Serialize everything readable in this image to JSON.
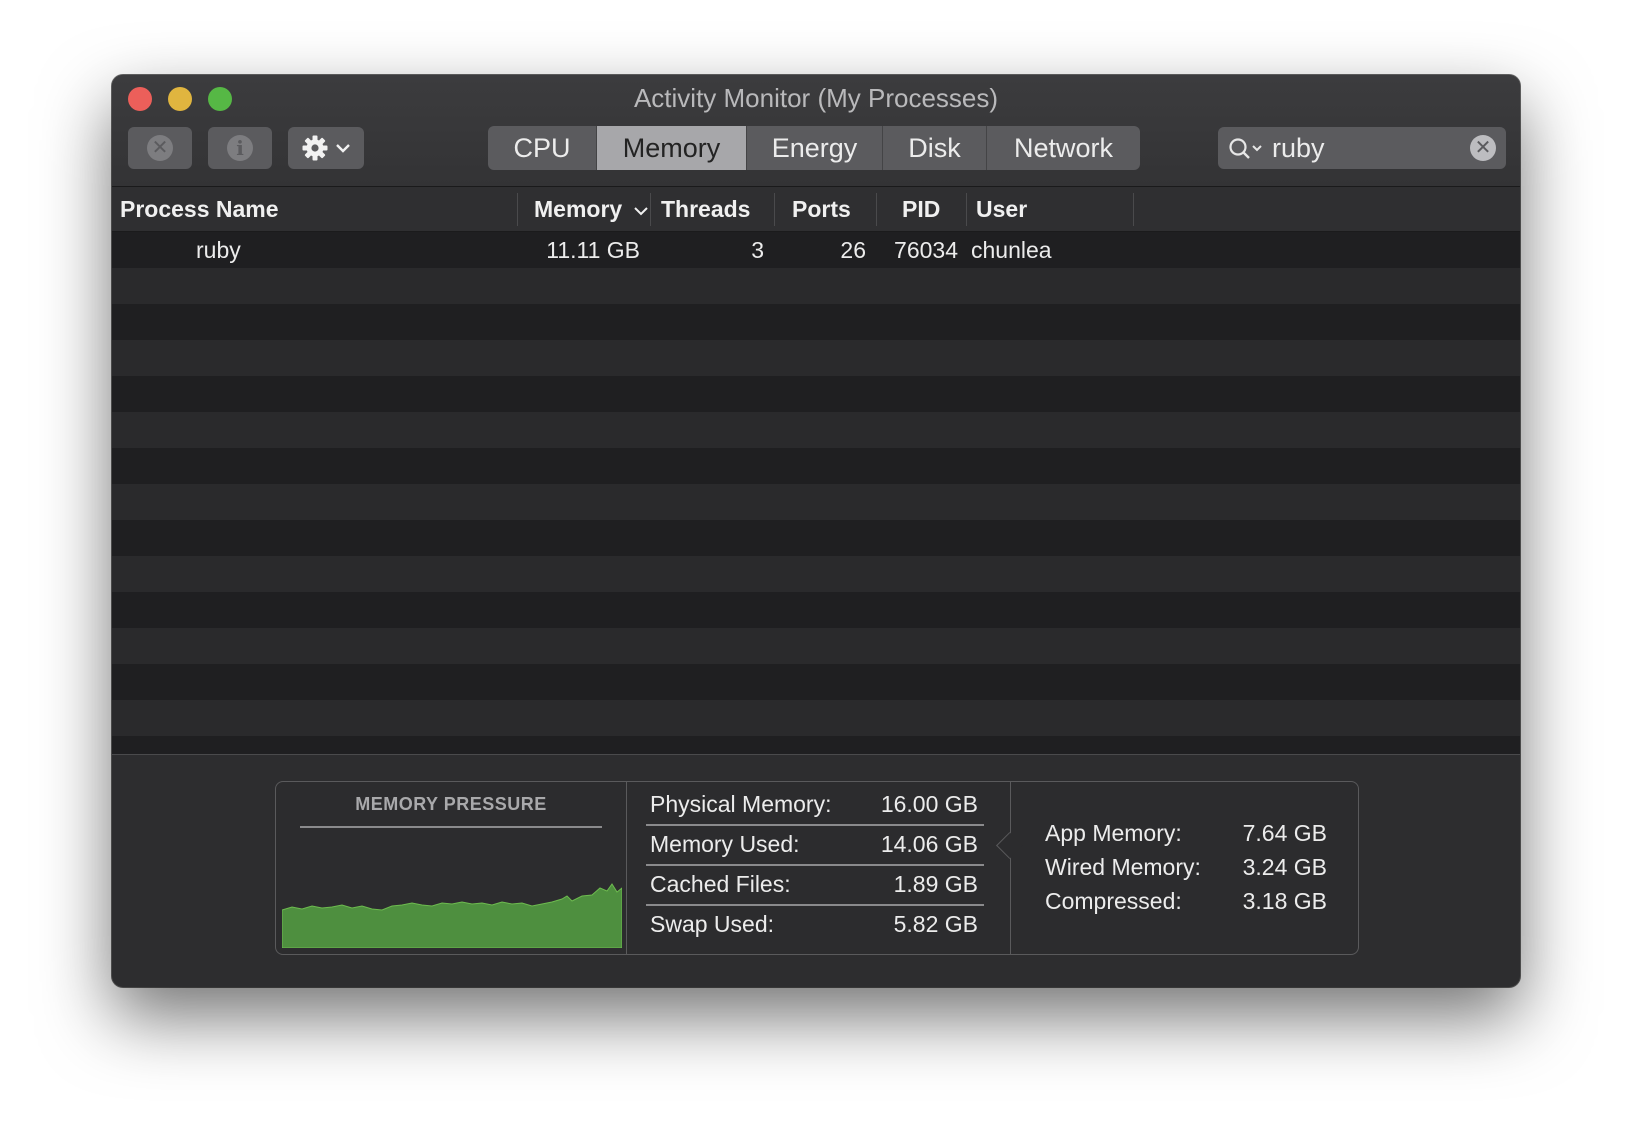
{
  "window": {
    "title": "Activity Monitor (My Processes)"
  },
  "toolbar": {
    "stop_icon": "stop-process-icon",
    "info_icon": "info-icon",
    "gear_icon": "gear-icon",
    "tabs": [
      {
        "label": "CPU",
        "active": false
      },
      {
        "label": "Memory",
        "active": true
      },
      {
        "label": "Energy",
        "active": false
      },
      {
        "label": "Disk",
        "active": false
      },
      {
        "label": "Network",
        "active": false
      }
    ],
    "search": {
      "value": "ruby"
    }
  },
  "table": {
    "columns": {
      "process_name": "Process Name",
      "memory": "Memory",
      "threads": "Threads",
      "ports": "Ports",
      "pid": "PID",
      "user": "User"
    },
    "sort_column": "Memory",
    "rows": [
      {
        "process_name": "ruby",
        "memory": "11.11 GB",
        "threads": "3",
        "ports": "26",
        "pid": "76034",
        "user": "chunlea"
      }
    ]
  },
  "stats": {
    "memory_pressure": {
      "title": "MEMORY PRESSURE",
      "color": "#4e8f3f"
    },
    "physical": [
      {
        "label": "Physical Memory:",
        "value": "16.00 GB"
      },
      {
        "label": "Memory Used:",
        "value": "14.06 GB"
      },
      {
        "label": "Cached Files:",
        "value": "1.89 GB"
      },
      {
        "label": "Swap Used:",
        "value": "5.82 GB"
      }
    ],
    "breakdown": [
      {
        "label": "App Memory:",
        "value": "7.64 GB"
      },
      {
        "label": "Wired Memory:",
        "value": "3.24 GB"
      },
      {
        "label": "Compressed:",
        "value": "3.18 GB"
      }
    ]
  }
}
